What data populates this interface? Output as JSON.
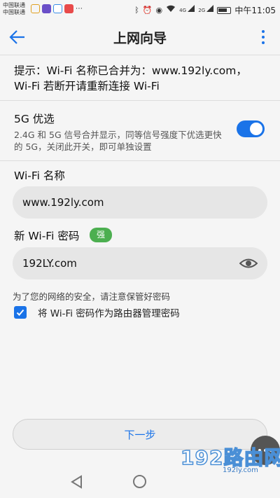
{
  "status_bar": {
    "carrier1": "中国联通",
    "carrier2": "中国联通",
    "signal1": "4G",
    "signal2": "2G",
    "time": "中午11:05"
  },
  "header": {
    "title": "上网向导"
  },
  "tip": {
    "line1": "提示：Wi-Fi 名称已合并为：www.192ly.com，",
    "line2": "Wi-Fi 若断开请重新连接 Wi-Fi"
  },
  "band_5g": {
    "title": "5G 优选",
    "description": "2.4G 和 5G 信号合并显示，同等信号强度下优选更快的 5G，关闭此开关，即可单独设置",
    "enabled": true
  },
  "wifi_name": {
    "label": "Wi-Fi 名称",
    "value": "www.192ly.com"
  },
  "wifi_password": {
    "label": "新 Wi-Fi 密码",
    "strength": "强",
    "value": "192LY.com"
  },
  "security_hint": "为了您的网络的安全，请注意保管好密码",
  "admin_checkbox": {
    "label": "将 Wi-Fi 密码作为路由器管理密码",
    "checked": true
  },
  "next_button": "下一步",
  "watermark": {
    "big": "192路由网",
    "small": "192ly.com"
  },
  "colors": {
    "accent": "#1a73e8",
    "badge": "#4caf50",
    "field_bg": "#e6e6e6",
    "page_bg": "#f5f5f5"
  }
}
